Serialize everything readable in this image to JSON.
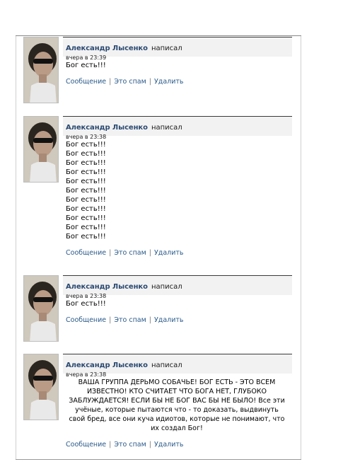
{
  "posts": [
    {
      "author": "Александр Лысенко",
      "action": "написал",
      "time": "вчера в 23:39",
      "lines": [
        "Бог есть!!!"
      ],
      "links": [
        "Сообщение",
        "Это спам",
        "Удалить"
      ]
    },
    {
      "author": "Александр Лысенко",
      "action": "написал",
      "time": "вчера в 23:38",
      "lines": [
        "Бог есть!!!",
        "Бог есть!!!",
        "Бог есть!!!",
        "Бог есть!!!",
        "Бог есть!!!",
        "Бог есть!!!",
        "Бог есть!!!",
        "Бог есть!!!",
        "Бог есть!!!",
        "Бог есть!!!",
        "Бог есть!!!"
      ],
      "links": [
        "Сообщение",
        "Это спам",
        "Удалить"
      ]
    },
    {
      "author": "Александр Лысенко",
      "action": "написал",
      "time": "вчера в 23:38",
      "lines": [
        "Бог есть!!!"
      ],
      "links": [
        "Сообщение",
        "Это спам",
        "Удалить"
      ]
    },
    {
      "author": "Александр Лысенко",
      "action": "написал",
      "time": "вчера в 23:38",
      "lines": [
        "ВАША ГРУППА ДЕРЬМО СОБАЧЬЕ! БОГ ЕСТЬ - ЭТО ВСЕМ",
        "ИЗВЕСТНО! КТО СЧИТАЕТ ЧТО БОГА НЕТ, ГЛУБОКО",
        "ЗАБЛУЖДАЕТСЯ! ЕСЛИ БЫ НЕ БОГ ВАС БЫ НЕ БЫЛО! Все эти",
        "учёные, которые пытаются что - то доказать, выдвинуть",
        "свой бред, все они куча идиотов, которые не понимают, что",
        "их создал Бог!"
      ],
      "links": [
        "Сообщение",
        "Это спам",
        "Удалить"
      ]
    }
  ]
}
